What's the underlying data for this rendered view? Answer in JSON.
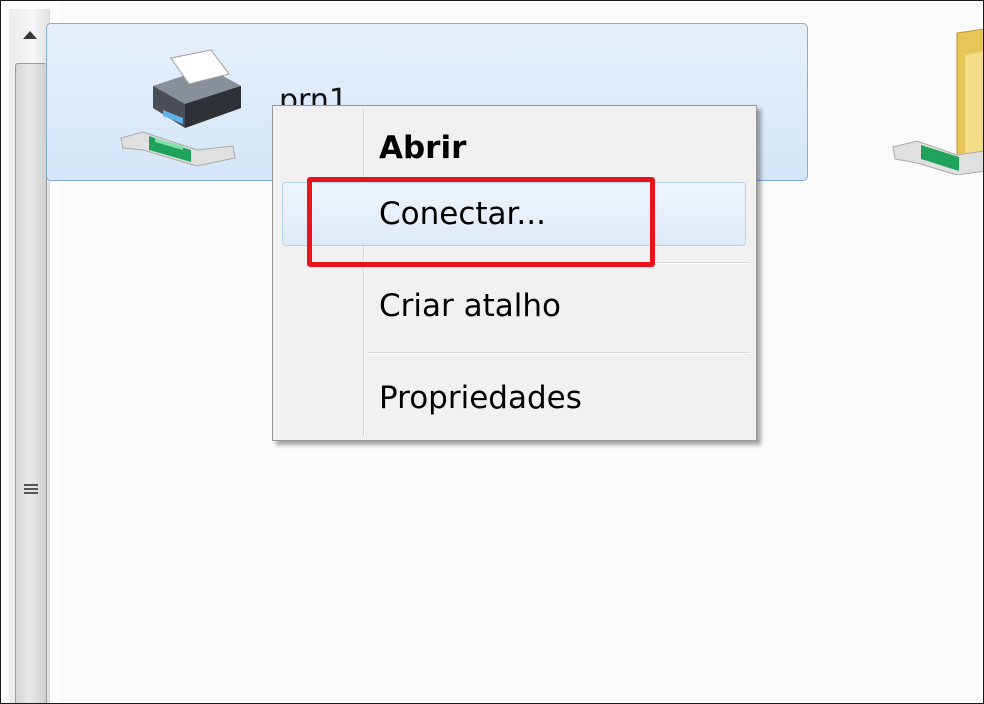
{
  "window": {
    "item": {
      "label": "prn1",
      "icon": "network-printer-icon"
    },
    "neighbor_item": {
      "icon": "network-folder-icon"
    }
  },
  "context_menu": {
    "items": [
      {
        "label": "Abrir",
        "bold": true
      },
      {
        "label": "Conectar...",
        "hovered": true,
        "annotated": true
      },
      {
        "label": "Criar atalho"
      },
      {
        "label": "Propriedades"
      }
    ]
  },
  "annotation": {
    "color": "#e8141c",
    "target": "Conectar..."
  },
  "colors": {
    "selection_border": "#84acdd",
    "selection_fill": "#d5e6f8",
    "menu_background": "#f1f1f1"
  }
}
